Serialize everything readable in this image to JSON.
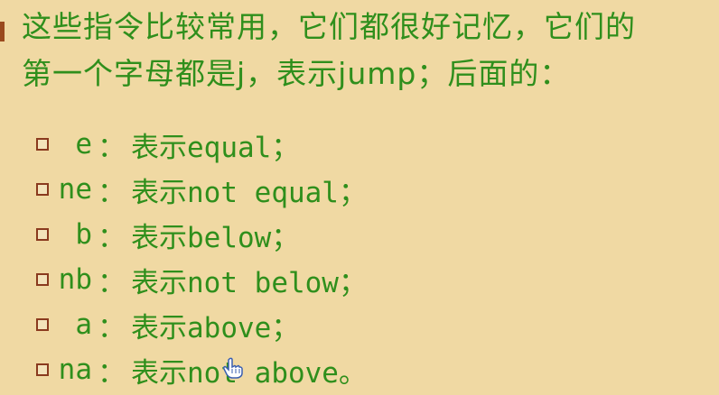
{
  "intro": {
    "line1": "这些指令比较常用，它们都很好记忆，它们的",
    "line2": "第一个字母都是j，表示jump；后面的："
  },
  "items": [
    {
      "code": "e",
      "sep": "：",
      "prefix": "表示",
      "word": "equal",
      "end": "；"
    },
    {
      "code": "ne",
      "sep": "：",
      "prefix": "表示",
      "word": "not equal",
      "end": "；"
    },
    {
      "code": "b",
      "sep": "：",
      "prefix": "表示",
      "word": "below",
      "end": "；"
    },
    {
      "code": "nb",
      "sep": "：",
      "prefix": "表示",
      "word": "not below",
      "end": "；"
    },
    {
      "code": "a",
      "sep": "：",
      "prefix": "表示",
      "word": "above",
      "end": "；"
    },
    {
      "code": "na",
      "sep": "：",
      "prefix": "表示",
      "word": "not above",
      "end": "。"
    }
  ],
  "colors": {
    "background": "#f0d9a3",
    "text": "#2f8f1c",
    "marker": "#8a3a1e"
  },
  "icons": {
    "cursor": "hand-pointer-icon"
  }
}
